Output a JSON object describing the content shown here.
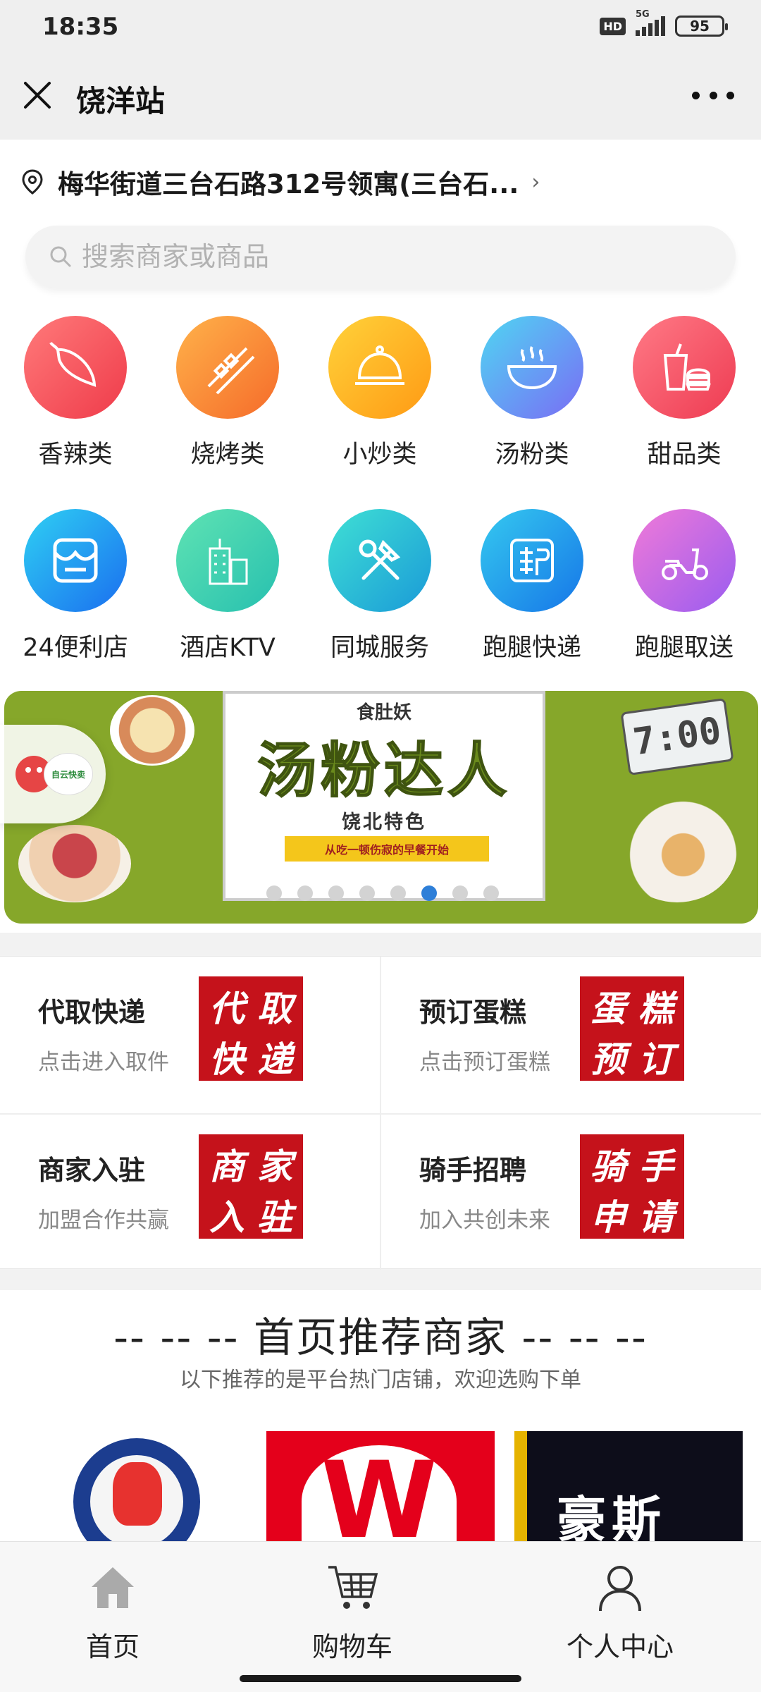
{
  "status_bar": {
    "time": "18:35",
    "hd": "HD",
    "network": "5G",
    "battery": "95"
  },
  "title_bar": {
    "title": "饶洋站",
    "close_icon": "close-icon",
    "more_icon": "more-dots-icon"
  },
  "address": {
    "text": "梅华街道三台石路312号领寓(三台石...",
    "icon": "location-pin-icon"
  },
  "search": {
    "placeholder": "搜索商家或商品"
  },
  "categories": [
    {
      "label": "香辣类",
      "icon": "chili-icon",
      "color_from": "#ff7a7a",
      "color_to": "#ef3b4a"
    },
    {
      "label": "烧烤类",
      "icon": "skewer-icon",
      "color_from": "#ffb24a",
      "color_to": "#f56b2a"
    },
    {
      "label": "小炒类",
      "icon": "dish-cover-icon",
      "color_from": "#ffd23a",
      "color_to": "#ff9a14"
    },
    {
      "label": "汤粉类",
      "icon": "soup-bowl-icon",
      "color_from": "#4fd6f2",
      "color_to": "#7a6cf5"
    },
    {
      "label": "甜品类",
      "icon": "drink-burger-icon",
      "color_from": "#ff7a86",
      "color_to": "#ee3b52"
    },
    {
      "label": "24便利店",
      "icon": "store-icon",
      "color_from": "#2fd0f2",
      "color_to": "#1a6ef0"
    },
    {
      "label": "酒店KTV",
      "icon": "building-icon",
      "color_from": "#5fe3b2",
      "color_to": "#27c0b0"
    },
    {
      "label": "同城服务",
      "icon": "tools-icon",
      "color_from": "#3fe0d4",
      "color_to": "#1a9ad8"
    },
    {
      "label": "跑腿快递",
      "icon": "courier-icon",
      "color_from": "#35c9ef",
      "color_to": "#1676e8"
    },
    {
      "label": "跑腿取送",
      "icon": "scooter-icon",
      "color_from": "#f07ad8",
      "color_to": "#9a5cf0"
    }
  ],
  "banner": {
    "subtitle": "食肚妖",
    "title": "汤粉达人",
    "tagline": "饶北特色",
    "strip": "从吃一顿伤寂的早餐开始",
    "clock": "7:00",
    "slide_count": 8,
    "active_slide": 6,
    "accent": "#86a72a"
  },
  "float_widget": {
    "logo_text": "自云快卖"
  },
  "services": [
    {
      "title": "代取快递",
      "subtitle": "点击进入取件",
      "tile": [
        "代",
        "取",
        "快",
        "递"
      ]
    },
    {
      "title": "预订蛋糕",
      "subtitle": "点击预订蛋糕",
      "tile": [
        "蛋",
        "糕",
        "预",
        "订"
      ]
    },
    {
      "title": "商家入驻",
      "subtitle": "加盟合作共赢",
      "tile": [
        "商",
        "家",
        "入",
        "驻"
      ]
    },
    {
      "title": "骑手招聘",
      "subtitle": "加入共创未来",
      "tile": [
        "骑",
        "手",
        "申",
        "请"
      ]
    }
  ],
  "recommend": {
    "title": "-- -- -- 首页推荐商家 -- -- --",
    "subtitle": "以下推荐的是平台热门店铺，欢迎选购下单",
    "shop3_text": "豪斯"
  },
  "bottom_nav": [
    {
      "label": "首页",
      "icon": "home-icon"
    },
    {
      "label": "购物车",
      "icon": "cart-icon"
    },
    {
      "label": "个人中心",
      "icon": "user-icon"
    }
  ]
}
